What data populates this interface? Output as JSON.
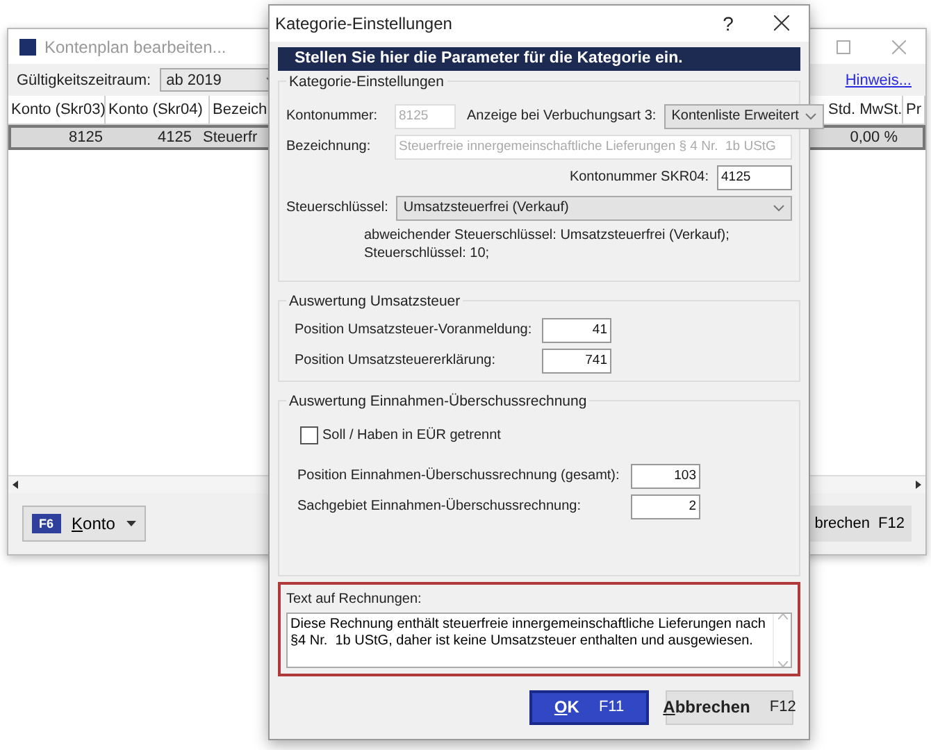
{
  "background_window": {
    "title": "Kontenplan bearbeiten...",
    "period_label": "Gültigkeitszeitraum:",
    "period_value": "ab 2019",
    "hint_link": "Hinweis...",
    "columns": [
      "Konto (Skr03)",
      "Konto (Skr04)",
      "Bezeich",
      "Std. MwSt.",
      "Pr"
    ],
    "rows": [
      {
        "cells": [
          "8125",
          "4125",
          "Steuerfr",
          "0,00 %"
        ],
        "selected": true
      }
    ],
    "account_button": {
      "key": "F6",
      "label": "Konto"
    },
    "cancel_button": {
      "label": "brechen",
      "key": "F12"
    }
  },
  "dialog": {
    "title": "Kategorie-Einstellungen",
    "help": "?",
    "banner": "Stellen Sie hier die Parameter für die Kategorie ein.",
    "category_group": {
      "title": "Kategorie-Einstellungen",
      "account_label": "Kontonummer:",
      "account_value": "8125",
      "account_disabled": true,
      "display_label": "Anzeige bei Verbuchungsart 3:",
      "display_value": "Kontenliste Erweitert",
      "name_label": "Bezeichnung:",
      "name_value": "Steuerfreie innergemeinschaftliche Lieferungen § 4 Nr.  1b UStG",
      "name_disabled": true,
      "skr04_label": "Kontonummer SKR04:",
      "skr04_value": "4125",
      "tax_key_label": "Steuerschlüssel:",
      "tax_key_value": "Umsatzsteuerfrei (Verkauf)",
      "tax_key_note": "abweichender Steuerschlüssel: Umsatzsteuerfrei (Verkauf); Steuerschlüssel: 10;"
    },
    "vat_group": {
      "title": "Auswertung Umsatzsteuer",
      "fields": [
        {
          "label": "Position Umsatzsteuer-Voranmeldung:",
          "value": "41"
        },
        {
          "label": "Position Umsatzsteuererklärung:",
          "value": "741"
        }
      ]
    },
    "eur_group": {
      "title": "Auswertung Einnahmen-Überschussrechnung",
      "checkbox": {
        "label": "Soll / Haben in EÜR getrennt",
        "checked": false
      },
      "fields": [
        {
          "label": "Position Einnahmen-Überschussrechnung (gesamt):",
          "value": "103"
        },
        {
          "label": "Sachgebiet Einnahmen-Überschussrechnung:",
          "value": "2"
        }
      ]
    },
    "invoice_text": {
      "label": "Text auf Rechnungen:",
      "value": "Diese Rechnung enthält steuerfreie innergemeinschaftliche Lieferungen nach §4 Nr.  1b UStG, daher ist keine Umsatzsteuer enthalten und ausgewiesen."
    },
    "buttons": [
      {
        "label": "OK",
        "key": "F11",
        "default": true
      },
      {
        "label": "Abbrechen",
        "key": "F12",
        "default": false
      }
    ]
  }
}
